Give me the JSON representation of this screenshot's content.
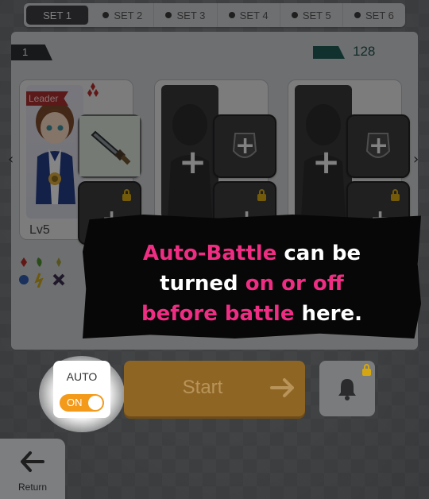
{
  "tabs": [
    {
      "label": "SET 1",
      "active": true
    },
    {
      "label": "SET 2",
      "active": false
    },
    {
      "label": "SET 3",
      "active": false
    },
    {
      "label": "SET 4",
      "active": false
    },
    {
      "label": "SET 5",
      "active": false
    },
    {
      "label": "SET 6",
      "active": false
    }
  ],
  "party": {
    "number": "1",
    "power": "128"
  },
  "leader_card": {
    "badge": "Leader",
    "level": "Lv5"
  },
  "tutorial": {
    "line1_pink": "Auto-Battle",
    "line1_white": " can be",
    "line2_white": "turned ",
    "line2_pink": "on or off",
    "line3_pink": "before battle",
    "line3_white": " here."
  },
  "controls": {
    "auto_label": "AUTO",
    "auto_state": "ON",
    "start_label": "Start",
    "return_label": "Return"
  },
  "colors": {
    "accent_pink": "#ef2e83",
    "toggle_orange": "#f39a1b",
    "start_orange": "#8f6524",
    "leader_red": "#a72f2f"
  },
  "icons": [
    "sword-icon",
    "shield-icon",
    "lock-icon",
    "bell-icon",
    "return-arrow-icon",
    "start-arrow-icon",
    "chevron-left-icon",
    "chevron-right-icon"
  ]
}
